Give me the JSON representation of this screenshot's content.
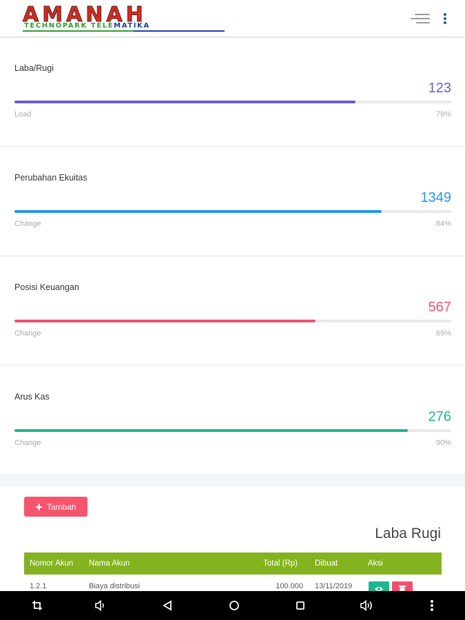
{
  "header": {
    "logo_main": "AMANAH",
    "logo_sub_1": "TECHNOPARK TELE",
    "logo_sub_2": "MATIKA"
  },
  "cards": [
    {
      "title": "Laba/Rugi",
      "value": "123",
      "label": "Load",
      "percent_text": "78%",
      "progress": 0.78,
      "color": "#6a5acd"
    },
    {
      "title": "Perubahan Ekuitas",
      "value": "1349",
      "label": "Change",
      "percent_text": "84%",
      "progress": 0.84,
      "color": "#2196f3"
    },
    {
      "title": "Posisi Keuangan",
      "value": "567",
      "label": "Change",
      "percent_text": "69%",
      "progress": 0.69,
      "color": "#f0506e"
    },
    {
      "title": "Arus Kas",
      "value": "276",
      "label": "Change",
      "percent_text": "90%",
      "progress": 0.9,
      "color": "#1fb58f"
    }
  ],
  "section": {
    "add_button": "Tambah",
    "title": "Laba Rugi"
  },
  "table": {
    "header_color": "#83b41f",
    "columns": [
      "Nomor Akun",
      "Nama Akun",
      "Total (Rp)",
      "Dibuat",
      "Aksi"
    ],
    "rows": [
      {
        "nomor": "1.2.1",
        "nama": "Biaya distribusi",
        "total": "100.000",
        "dibuat": "13/11/2019"
      }
    ]
  },
  "colors": {
    "view_button": "#1fb58f",
    "delete_button": "#f0506e"
  },
  "icons": {
    "menu": "menu-lines-icon",
    "more": "more-vert-icon",
    "view": "eye-icon",
    "delete": "trash-icon",
    "nav": [
      "screenshot-icon",
      "volume-down-icon",
      "back-icon",
      "home-icon",
      "recents-icon",
      "volume-up-icon",
      "more-icon"
    ]
  }
}
